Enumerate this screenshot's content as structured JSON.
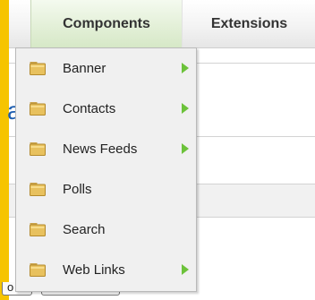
{
  "menubar": {
    "items": [
      {
        "label": "Components"
      },
      {
        "label": "Extensions"
      }
    ]
  },
  "background": {
    "partial_letter": "a",
    "partial_text_bottom": "o"
  },
  "dropdown": {
    "items": [
      {
        "label": "Banner",
        "icon": "folder-icon",
        "has_submenu": true
      },
      {
        "label": "Contacts",
        "icon": "folder-icon",
        "has_submenu": true
      },
      {
        "label": "News Feeds",
        "icon": "folder-icon",
        "has_submenu": true
      },
      {
        "label": "Polls",
        "icon": "folder-icon",
        "has_submenu": false
      },
      {
        "label": "Search",
        "icon": "folder-icon",
        "has_submenu": false
      },
      {
        "label": "Web Links",
        "icon": "folder-icon",
        "has_submenu": true
      }
    ]
  },
  "colors": {
    "frame": "#f6c400",
    "active_menu": "#dceccf",
    "submenu_arrow": "#6cc23a",
    "link_blue": "#1f5fb0"
  }
}
